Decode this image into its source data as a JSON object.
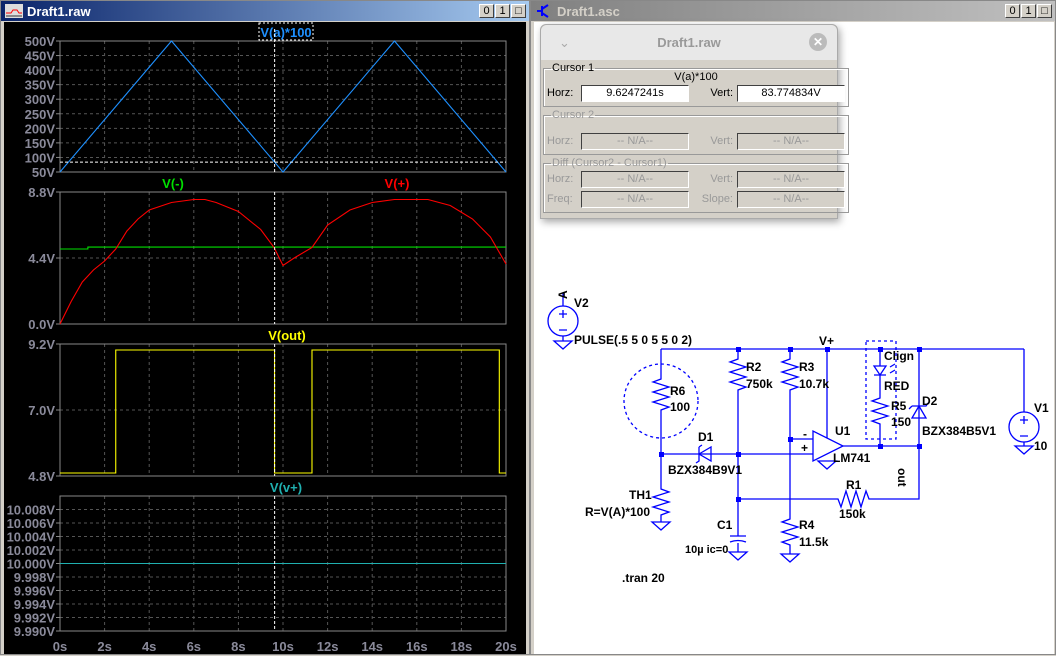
{
  "waveform_window": {
    "title": "Draft1.raw",
    "buttons": [
      "0",
      "1",
      "□"
    ]
  },
  "schematic_window": {
    "title": "Draft1.asc",
    "buttons": [
      "0",
      "1",
      "□"
    ]
  },
  "cursor_dialog": {
    "title": "Draft1.raw",
    "close": "✕",
    "chevron": "⌄",
    "cursor1": {
      "legend": "Cursor 1",
      "trace": "V(a)*100",
      "horz_label": "Horz:",
      "horz": "9.6247241s",
      "vert_label": "Vert:",
      "vert": "83.774834V"
    },
    "cursor2": {
      "legend": "Cursor 2",
      "horz_label": "Horz:",
      "horz": "-- N/A--",
      "vert_label": "Vert:",
      "vert": "-- N/A--"
    },
    "diff": {
      "legend": "Diff (Cursor2 - Cursor1)",
      "horz_label": "Horz:",
      "horz": "-- N/A--",
      "vert_label": "Vert:",
      "vert": "-- N/A--",
      "freq_label": "Freq:",
      "freq": "-- N/A--",
      "slope_label": "Slope:",
      "slope": "-- N/A--"
    }
  },
  "chart_data": [
    {
      "type": "line",
      "xlim": [
        0,
        20
      ],
      "ylim": [
        50,
        500
      ],
      "yticks": [
        "500V",
        "450V",
        "400V",
        "350V",
        "300V",
        "250V",
        "200V",
        "150V",
        "100V",
        "50V"
      ],
      "ytickvals": [
        500,
        450,
        400,
        350,
        300,
        250,
        200,
        150,
        100,
        50
      ],
      "series": [
        {
          "name": "V(a)*100",
          "color": "#1e90ff",
          "x": [
            0,
            5,
            10,
            15,
            20
          ],
          "y": [
            50,
            500,
            50,
            500,
            50
          ]
        }
      ],
      "cursor": {
        "x": 9.6247241,
        "y": 83.774834
      }
    },
    {
      "type": "line",
      "xlim": [
        0,
        20
      ],
      "ylim": [
        0,
        8.8
      ],
      "yticks": [
        "8.8V",
        "4.4V",
        "0.0V"
      ],
      "ytickvals": [
        8.8,
        4.4,
        0
      ],
      "series": [
        {
          "name": "V(-)",
          "color": "#00e000",
          "x": [
            0,
            1.25,
            1.25,
            20
          ],
          "y": [
            5.0,
            5.0,
            5.13,
            5.13
          ]
        },
        {
          "name": "V(+)",
          "color": "#ff0000",
          "x": [
            0,
            0.5,
            1,
            1.5,
            2,
            2.5,
            3,
            3.5,
            4,
            5,
            6,
            6.5,
            7,
            8,
            9,
            9.6,
            10,
            10.5,
            11.3,
            12,
            13,
            14,
            15,
            16.5,
            17.5,
            18.5,
            19.3,
            20
          ],
          "y": [
            0,
            1.5,
            2.8,
            3.6,
            4.2,
            5.0,
            6.2,
            7.0,
            7.6,
            8.1,
            8.3,
            8.3,
            8.1,
            7.5,
            6.3,
            5.1,
            3.9,
            4.4,
            5.1,
            6.6,
            7.6,
            8.1,
            8.3,
            8.3,
            7.9,
            7.0,
            5.8,
            4.0
          ]
        }
      ]
    },
    {
      "type": "line",
      "xlim": [
        0,
        20
      ],
      "ylim": [
        4.8,
        9.2
      ],
      "yticks": [
        "9.2V",
        "7.0V",
        "4.8V"
      ],
      "ytickvals": [
        9.2,
        7.0,
        4.8
      ],
      "series": [
        {
          "name": "V(out)",
          "color": "#ffff00",
          "x": [
            0,
            2.5,
            2.5,
            9.62,
            9.62,
            11.3,
            11.3,
            19.7,
            19.7,
            20
          ],
          "y": [
            4.9,
            4.9,
            9.0,
            9.0,
            4.9,
            4.9,
            9.0,
            9.0,
            4.9,
            4.9
          ]
        }
      ]
    },
    {
      "type": "line",
      "xlim": [
        0,
        20
      ],
      "ylim": [
        9.99,
        10.01
      ],
      "yticks": [
        "10.008V",
        "10.006V",
        "10.004V",
        "10.002V",
        "10.000V",
        "9.998V",
        "9.996V",
        "9.994V",
        "9.992V",
        "9.990V"
      ],
      "ytickvals": [
        10.008,
        10.006,
        10.004,
        10.002,
        10.0,
        9.998,
        9.996,
        9.994,
        9.992,
        9.99
      ],
      "series": [
        {
          "name": "V(v+)",
          "color": "#20b0b0",
          "x": [
            0,
            20
          ],
          "y": [
            10.0,
            10.0
          ]
        }
      ]
    }
  ],
  "xaxis": {
    "ticks": [
      "0s",
      "2s",
      "4s",
      "6s",
      "8s",
      "10s",
      "12s",
      "14s",
      "16s",
      "18s",
      "20s"
    ],
    "vals": [
      0,
      2,
      4,
      6,
      8,
      10,
      12,
      14,
      16,
      18,
      20
    ]
  },
  "schematic": {
    "labels": {
      "v2": "V2",
      "v2_node": "A",
      "v2_value": "PULSE(.5 5 0 5 5 0 2)",
      "r6": "R6",
      "r6_value": "100",
      "d1": "D1",
      "d1_value": "BZX384B9V1",
      "th1": "TH1",
      "th1_value": "R=V(A)*100",
      "r2": "R2",
      "r2_value": "750k",
      "c1": "C1",
      "c1_value": "10µ ic=0",
      "r3": "R3",
      "r3_value": "10.7k",
      "r4": "R4",
      "r4_value": "11.5k",
      "vplus": "V+",
      "u1": "U1",
      "u1_value": "LM741",
      "r1": "R1",
      "r1_value": "150k",
      "clign": "Clign",
      "led_value": "RED",
      "r5": "R5",
      "r5_value": "150",
      "d2": "D2",
      "d2_value": "BZX384B5V1",
      "out": "out",
      "v1": "V1",
      "v1_value": "10",
      "directive": ".tran 20",
      "minus": "-",
      "plus": "+"
    },
    "wire_color": "#0000ff"
  }
}
